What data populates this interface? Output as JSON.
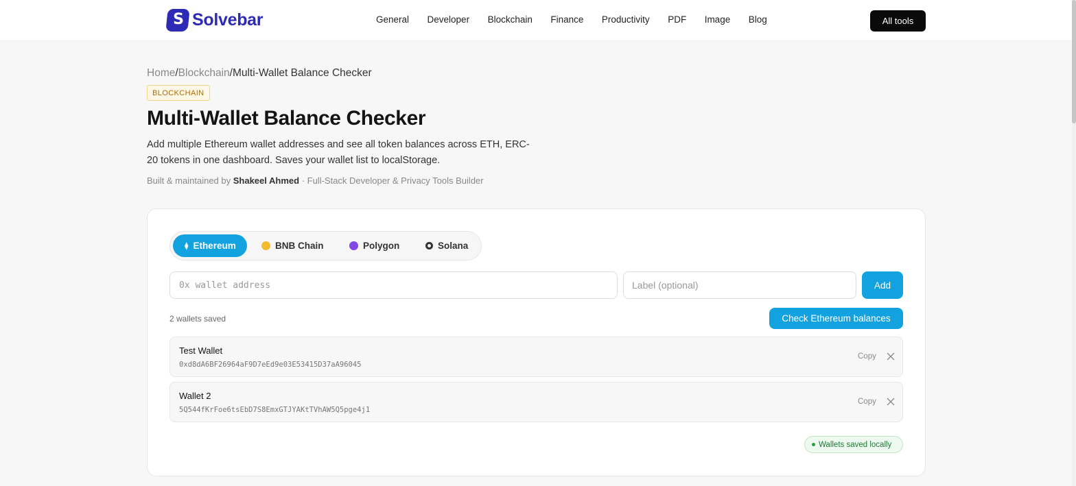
{
  "header": {
    "logo_mark": "S",
    "logo_text": "Solvebar",
    "nav": [
      "General",
      "Developer",
      "Blockchain",
      "Finance",
      "Productivity",
      "PDF",
      "Image",
      "Blog"
    ],
    "all_tools": "All tools"
  },
  "breadcrumb": {
    "home": "Home",
    "sep": "/",
    "section": "Blockchain",
    "current": "Multi-Wallet Balance Checker"
  },
  "category_badge": "BLOCKCHAIN",
  "title": "Multi-Wallet Balance Checker",
  "description": "Add multiple Ethereum wallet addresses and see all token balances across ETH, ERC-20 tokens in one dashboard. Saves your wallet list to localStorage.",
  "byline": {
    "prefix": "Built & maintained by ",
    "author": "Shakeel Ahmed",
    "suffix": " · Full-Stack Developer & Privacy Tools Builder"
  },
  "chains": [
    {
      "label": "Ethereum",
      "icon": "ethereum-icon",
      "active": true
    },
    {
      "label": "BNB Chain",
      "icon": "bnb-icon",
      "active": false
    },
    {
      "label": "Polygon",
      "icon": "polygon-icon",
      "active": false
    },
    {
      "label": "Solana",
      "icon": "solana-icon",
      "active": false
    }
  ],
  "form": {
    "address_placeholder": "0x wallet address",
    "label_placeholder": "Label (optional)",
    "add_button": "Add",
    "check_button": "Check Ethereum balances"
  },
  "saved_count": "2 wallets saved",
  "wallets": [
    {
      "label": "Test Wallet",
      "address": "0xd8dA6BF26964aF9D7eEd9e03E53415D37aA96045",
      "copy": "Copy"
    },
    {
      "label": "Wallet 2",
      "address": "5Q544fKrFoe6tsEbD7S8EmxGTJYAKtTVhAW5Q5pge4j1",
      "copy": "Copy"
    }
  ],
  "saved_badge": "Wallets saved locally",
  "colors": {
    "accent": "#12a2e0",
    "brand": "#2d2bb5",
    "bnb": "#f3ba2f",
    "polygon": "#8247e5",
    "success": "#1fa33b"
  }
}
